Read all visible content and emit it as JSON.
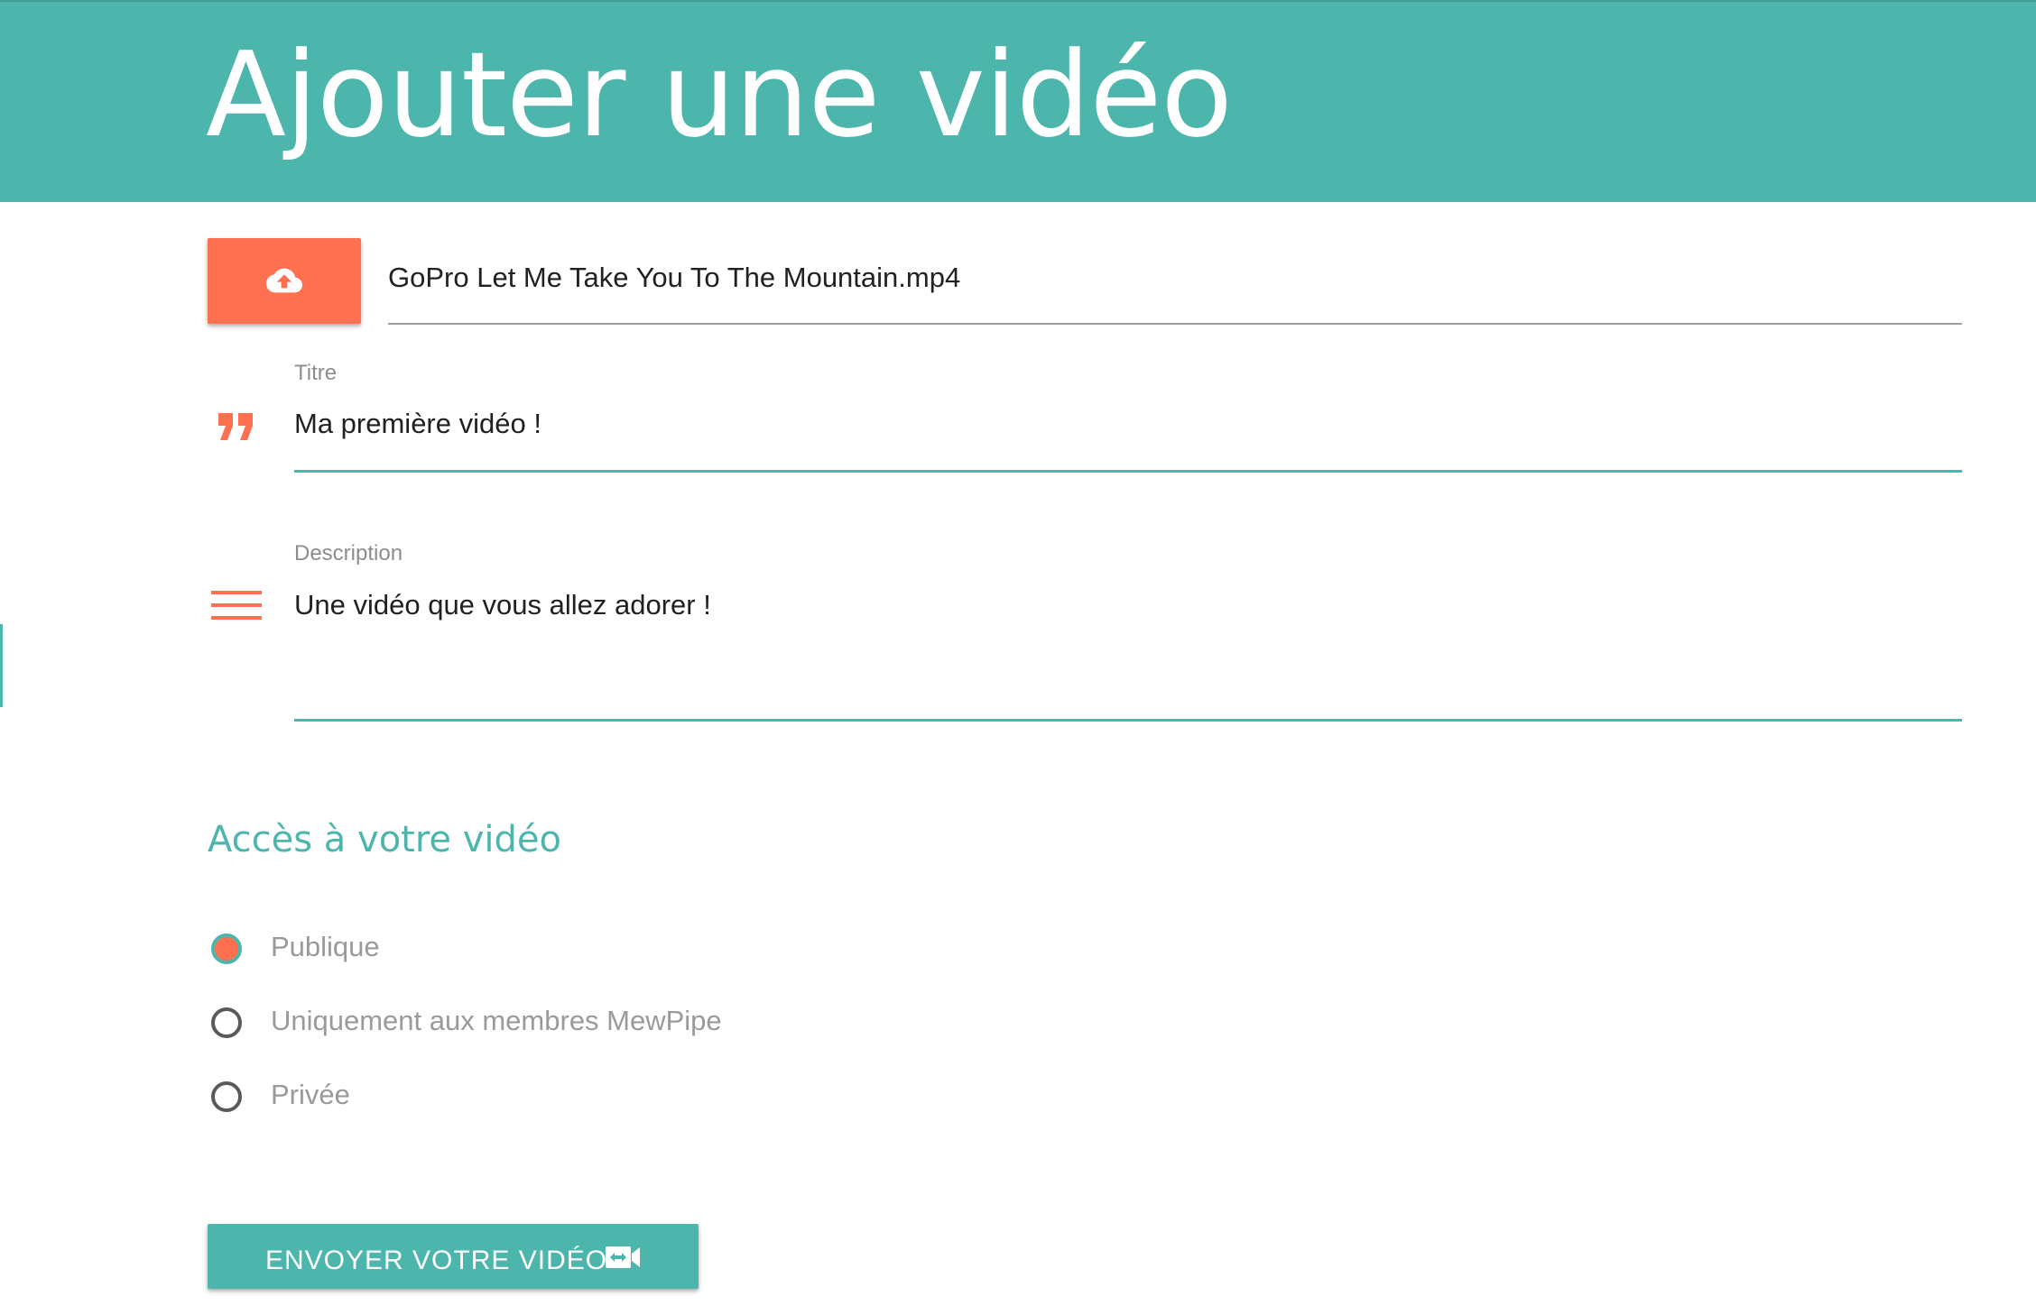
{
  "header": {
    "title": "Ajouter une vidéo"
  },
  "upload": {
    "button_icon": "cloud-upload-icon",
    "file_name": "GoPro Let Me Take You To The Mountain.mp4"
  },
  "form": {
    "title_field": {
      "label": "Titre",
      "value": "Ma première vidéo !",
      "icon": "format-quote-icon"
    },
    "description_field": {
      "label": "Description",
      "value": "Une vidéo que vous allez adorer !",
      "icon": "menu-lines-icon"
    }
  },
  "access": {
    "title": "Accès à votre vidéo",
    "options": [
      {
        "label": "Publique",
        "checked": true
      },
      {
        "label": "Uniquement aux membres MewPipe",
        "checked": false
      },
      {
        "label": "Privée",
        "checked": false
      }
    ]
  },
  "submit": {
    "label": "ENVOYER VOTRE VIDÉO",
    "icon": "switch-video-icon"
  },
  "colors": {
    "primary_teal": "#4db6ac",
    "accent_orange": "#ff7050",
    "text_dark": "#212121",
    "text_muted": "#9a9a9a"
  }
}
